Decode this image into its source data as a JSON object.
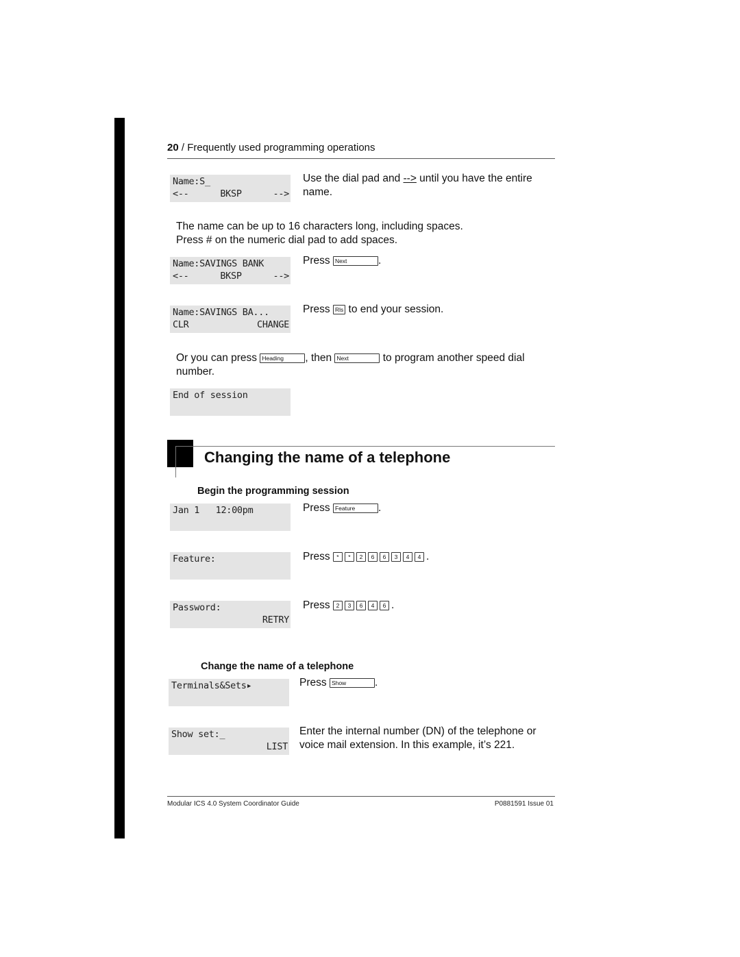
{
  "page": {
    "running_head": {
      "page_number": "20",
      "separator": " / ",
      "title": "Frequently used programming operations"
    },
    "section1": {
      "step1": {
        "display": {
          "line1": "Name:S_",
          "line2": [
            "<--",
            "BKSP",
            "-->"
          ]
        },
        "text_before": "Use the dial pad and ",
        "arrow": "-->",
        "text_after": " until you have the entire name."
      },
      "note_line1": "The name can be up to 16 characters long, including spaces.",
      "note_line2": "Press # on the numeric dial pad to add spaces.",
      "step2": {
        "display": {
          "line1": "Name:SAVINGS BANK",
          "line2": [
            "<--",
            "BKSP",
            "-->"
          ]
        },
        "press": "Press",
        "key": "Next",
        "end": "."
      },
      "step3": {
        "display": {
          "line1": "Name:SAVINGS BA...",
          "line2": [
            "CLR",
            "CHANGE"
          ]
        },
        "press": "Press",
        "key": "Rls",
        "end": " to end your session."
      },
      "alt": {
        "text1": "Or you can press ",
        "key1": "Heading",
        "text2": ", then ",
        "key2": "Next",
        "text3": " to program another speed dial number."
      },
      "end_display": {
        "line1": "End of session"
      }
    },
    "section2": {
      "heading": "Changing the name of a telephone",
      "sub1": {
        "heading": "Begin the programming session",
        "step1": {
          "display": {
            "line1": "Jan 1   12:00pm"
          },
          "press": "Press",
          "key": "Feature",
          "end": "."
        },
        "step2": {
          "display": {
            "line1": "Feature:"
          },
          "press": "Press",
          "keys": [
            "*",
            "*",
            "2",
            "6",
            "6",
            "3",
            "4",
            "4"
          ],
          "end": "."
        },
        "step3": {
          "display": {
            "line1": "Password:",
            "line2": "RETRY"
          },
          "press": "Press",
          "keys": [
            "2",
            "3",
            "6",
            "4",
            "6"
          ],
          "end": "."
        }
      },
      "sub2": {
        "heading": "Change the name of a telephone",
        "step1": {
          "display": {
            "line1": "Terminals&Sets▸"
          },
          "press": "Press",
          "key": "Show",
          "end": "."
        },
        "step2": {
          "display": {
            "line1": "Show set:_",
            "line2": "LIST"
          },
          "text": "Enter the internal number (DN) of the telephone or voice mail extension. In this example, it’s 221."
        }
      }
    },
    "footer": {
      "left": "Modular ICS 4.0 System Coordinator Guide",
      "right": "P0881591 Issue 01"
    }
  }
}
